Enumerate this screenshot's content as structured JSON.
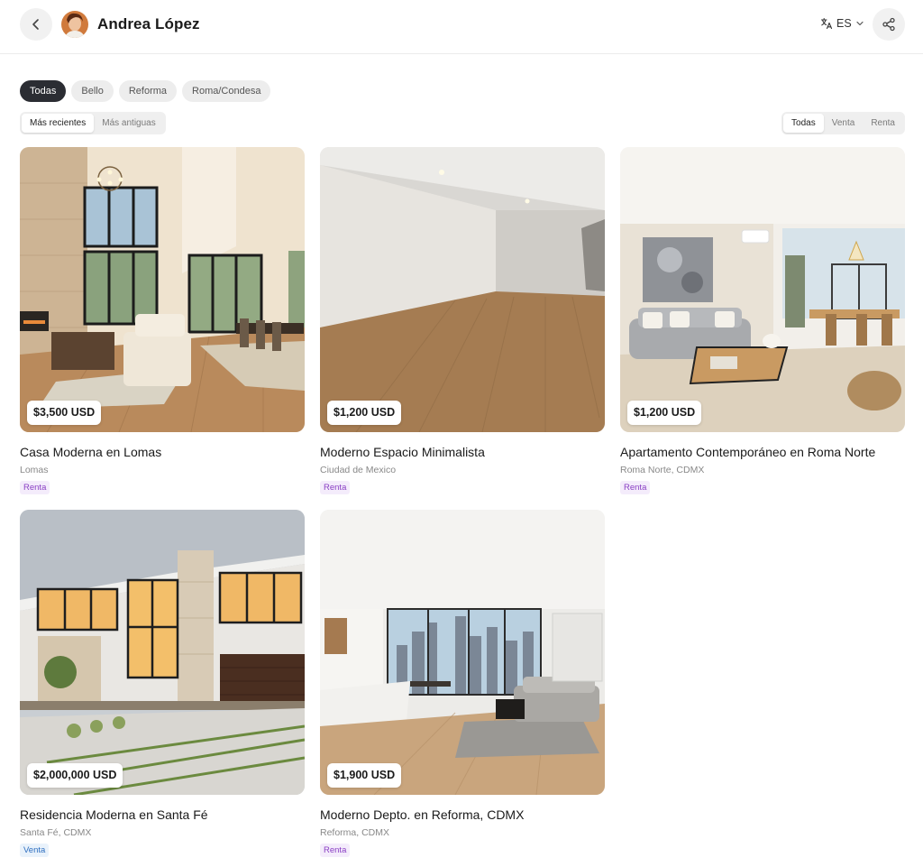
{
  "header": {
    "agent_name": "Andrea López",
    "language": "ES"
  },
  "filters": {
    "zones": [
      "Todas",
      "Bello",
      "Reforma",
      "Roma/Condesa"
    ],
    "zones_selected": "Todas",
    "sort": [
      "Más recientes",
      "Más antiguas"
    ],
    "sort_selected": "Más recientes",
    "types": [
      "Todas",
      "Venta",
      "Renta"
    ],
    "types_selected": "Todas"
  },
  "listings": [
    {
      "price": "$3,500 USD",
      "title": "Casa Moderna en Lomas",
      "location": "Lomas",
      "tag": "Renta"
    },
    {
      "price": "$1,200 USD",
      "title": "Moderno Espacio Minimalista",
      "location": "Ciudad de Mexico",
      "tag": "Renta"
    },
    {
      "price": "$1,200 USD",
      "title": "Apartamento Contemporáneo en Roma Norte",
      "location": "Roma Norte, CDMX",
      "tag": "Renta"
    },
    {
      "price": "$2,000,000 USD",
      "title": "Residencia Moderna en Santa Fé",
      "location": "Santa Fé, CDMX",
      "tag": "Venta"
    },
    {
      "price": "$1,900 USD",
      "title": "Moderno Depto. en Reforma, CDMX",
      "location": "Reforma, CDMX",
      "tag": "Renta"
    }
  ],
  "icons": {
    "back": "chevron-left-icon",
    "language": "translate-icon",
    "dropdown": "chevron-down-icon",
    "share": "share-icon"
  },
  "colors": {
    "chip_active": "#2b2d33",
    "tag_renta": "#8a3fc4",
    "tag_venta": "#2f6fc0"
  }
}
